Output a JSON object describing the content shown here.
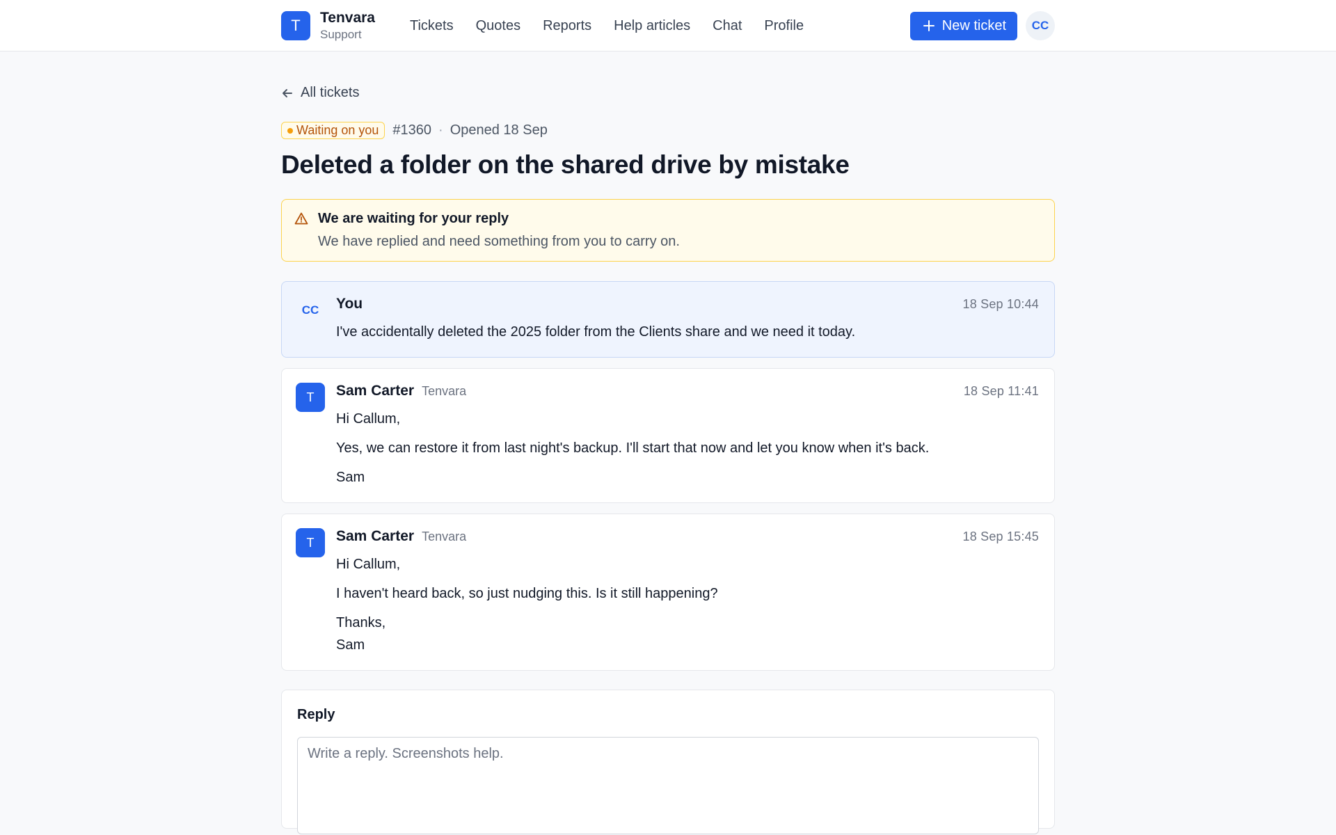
{
  "header": {
    "brand_initial": "T",
    "brand_name": "Tenvara",
    "brand_sub": "Support",
    "nav": [
      "Tickets",
      "Quotes",
      "Reports",
      "Help articles",
      "Chat",
      "Profile"
    ],
    "new_ticket_label": "New ticket",
    "user_initials": "CC"
  },
  "back_link": "All tickets",
  "ticket": {
    "status": "Waiting on you",
    "id": "#1360",
    "separator": "·",
    "opened": "Opened 18 Sep",
    "title": "Deleted a folder on the shared drive by mistake"
  },
  "alert": {
    "title": "We are waiting for your reply",
    "text": "We have replied and need something from you to carry on."
  },
  "messages": [
    {
      "avatar": "CC",
      "author": "You",
      "org": "",
      "time": "18 Sep 10:44",
      "paragraphs": [
        "I've accidentally deleted the 2025 folder from the Clients share and we need it today."
      ]
    },
    {
      "avatar": "T",
      "author": "Sam Carter",
      "org": "Tenvara",
      "time": "18 Sep 11:41",
      "paragraphs": [
        "Hi Callum,",
        "Yes, we can restore it from last night's backup. I'll start that now and let you know when it's back.",
        "Sam"
      ]
    },
    {
      "avatar": "T",
      "author": "Sam Carter",
      "org": "Tenvara",
      "time": "18 Sep 15:45",
      "paragraphs": [
        "Hi Callum,",
        "I haven't heard back, so just nudging this. Is it still happening?",
        "Thanks,",
        "Sam"
      ]
    }
  ],
  "reply": {
    "label": "Reply",
    "placeholder": "Write a reply. Screenshots help.",
    "value": ""
  },
  "colors": {
    "accent": "#2563eb",
    "warning_bg": "#fffbeb",
    "warning_border": "#fcd34d",
    "warning_text": "#b45309"
  },
  "icons": {
    "back": "arrow-left-icon",
    "alert": "warning-triangle-icon",
    "new_ticket": "plus-icon"
  }
}
